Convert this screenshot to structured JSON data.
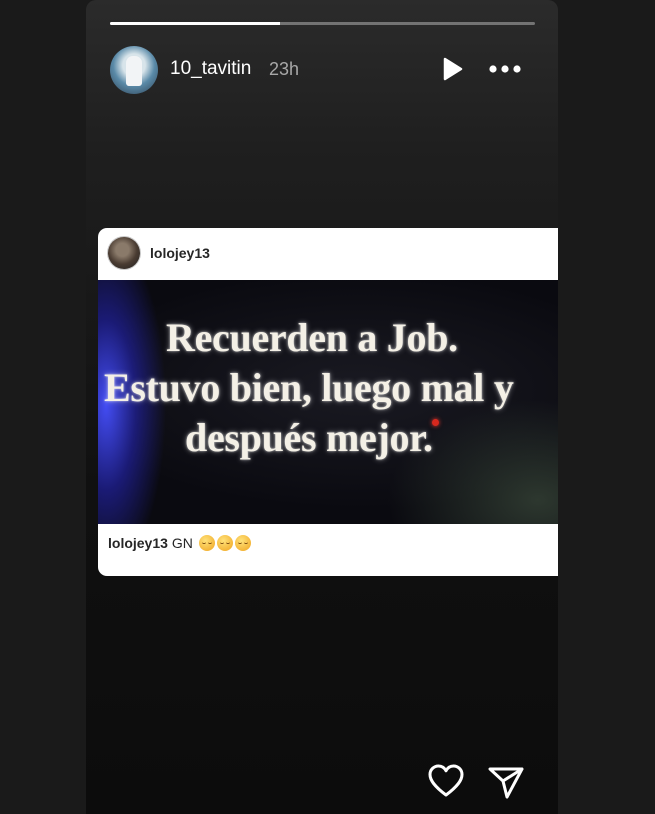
{
  "story": {
    "progress": 0.4,
    "author": {
      "username": "10_tavitin",
      "time_ago": "23h"
    },
    "controls": {
      "play_icon": "play-icon",
      "more_icon": "more-horizontal-icon"
    }
  },
  "shared_post": {
    "username": "lolojey13",
    "image_text": {
      "line1": "Recuerden a Job.",
      "line2": "Estuvo bien, luego mal y",
      "line3": "después mejor."
    },
    "caption": {
      "username": "lolojey13",
      "text": "GN",
      "emoji_icon": "sleeping-face-emoji",
      "emoji_count": 3
    }
  },
  "footer": {
    "like_icon": "heart-icon",
    "share_icon": "send-icon"
  },
  "colors": {
    "page_bg": "#1a1a1a",
    "card_bg": "#ffffff",
    "text_dark": "#262626",
    "text_muted": "#a8a8a8"
  }
}
